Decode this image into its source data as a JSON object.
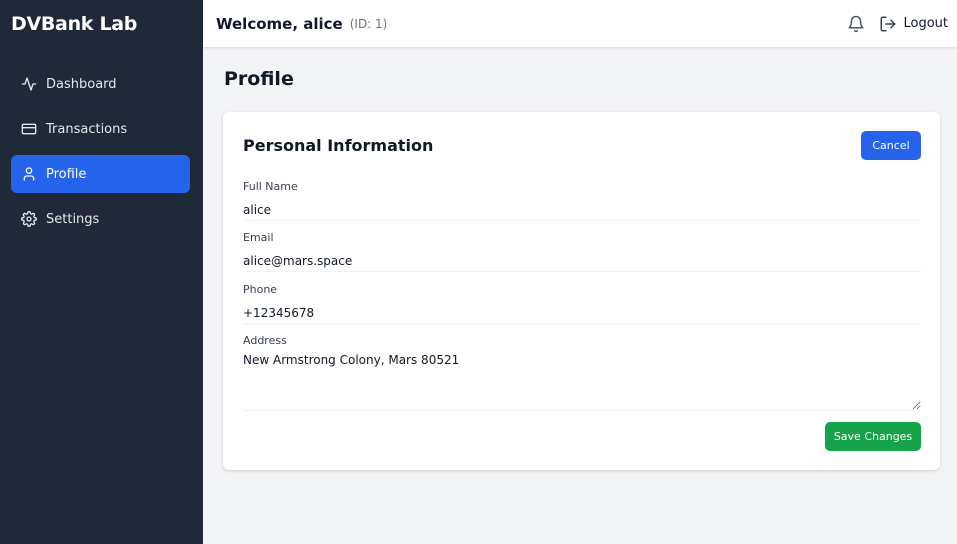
{
  "app": {
    "brand": "DVBank Lab"
  },
  "sidebar": {
    "items": [
      {
        "label": "Dashboard",
        "icon": "activity-icon",
        "active": false
      },
      {
        "label": "Transactions",
        "icon": "credit-card-icon",
        "active": false
      },
      {
        "label": "Profile",
        "icon": "user-icon",
        "active": true
      },
      {
        "label": "Settings",
        "icon": "gear-icon",
        "active": false
      }
    ]
  },
  "header": {
    "welcome": "Welcome, alice",
    "user_id": "(ID: 1)",
    "logout_label": "Logout",
    "notifications_icon": "bell-icon",
    "logout_icon": "logout-icon"
  },
  "page": {
    "title": "Profile"
  },
  "card": {
    "title": "Personal Information",
    "cancel_label": "Cancel",
    "save_label": "Save Changes",
    "fields": {
      "full_name": {
        "label": "Full Name",
        "value": "alice"
      },
      "email": {
        "label": "Email",
        "value": "alice@mars.space"
      },
      "phone": {
        "label": "Phone",
        "value": "+12345678"
      },
      "address": {
        "label": "Address",
        "value": "New Armstrong Colony, Mars 80521"
      }
    }
  },
  "colors": {
    "sidebar_bg": "#1f2937",
    "accent": "#2563eb",
    "success": "#16a34a",
    "page_bg": "#f3f4f6"
  }
}
